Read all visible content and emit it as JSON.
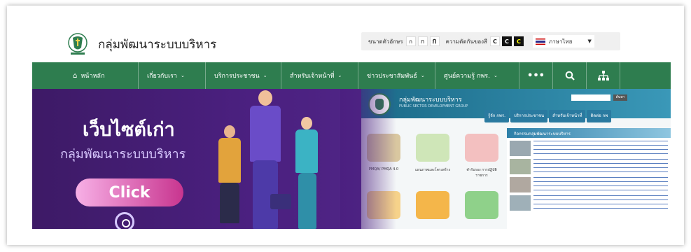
{
  "header": {
    "site_title": "กลุ่มพัฒนาระบบบริหาร"
  },
  "tools": {
    "font_size_label": "ขนาดตัวอักษร",
    "font_sizes": [
      "ก",
      "ก",
      "ก"
    ],
    "contrast_label": "ความตัดกันของสี",
    "contrast_options": [
      "C",
      "C",
      "C"
    ],
    "language": "ภาษาไทย"
  },
  "nav": {
    "items": [
      {
        "label": "หน้าหลัก",
        "icon": "home-icon",
        "caret": false
      },
      {
        "label": "เกี่ยวกับเรา",
        "caret": true
      },
      {
        "label": "บริการประชาชน",
        "caret": true
      },
      {
        "label": "สำหรับเจ้าหน้าที่",
        "caret": true
      },
      {
        "label": "ข่าวประชาสัมพันธ์",
        "caret": true
      },
      {
        "label": "ศูนย์ความรู้ กพร.",
        "caret": true
      }
    ],
    "more_label": "•••",
    "search_icon": "search-icon",
    "sitemap_icon": "sitemap-icon"
  },
  "banner": {
    "title": "เว็บไซต์เก่า",
    "subtitle": "กลุ่มพัฒนาระบบบริหาร",
    "click_label": "Click"
  },
  "old_site": {
    "title": "กลุ่มพัฒนาระบบบริหาร",
    "subtitle": "PUBLIC SECTOR DEVELOPMENT GROUP",
    "search_button": "ค้นหา",
    "nav": [
      "รู้จัก กพร.",
      "บริการประชาชน",
      "สำหรับเจ้าหน้าที่",
      "ติดต่อ กพ"
    ],
    "news_header": "กิจกรรมกลุ่มพัฒนาระบบบริหาร",
    "tiles": [
      "PMQA/ PMQA 4.0",
      "แผนภาพและโครงสร้าง",
      "คำรับรอง การปฏิบัติราชการ"
    ]
  },
  "colors": {
    "nav_green": "#2e7d4f",
    "banner_purple": "#4a1e78",
    "click_pink": "#c8358f"
  }
}
